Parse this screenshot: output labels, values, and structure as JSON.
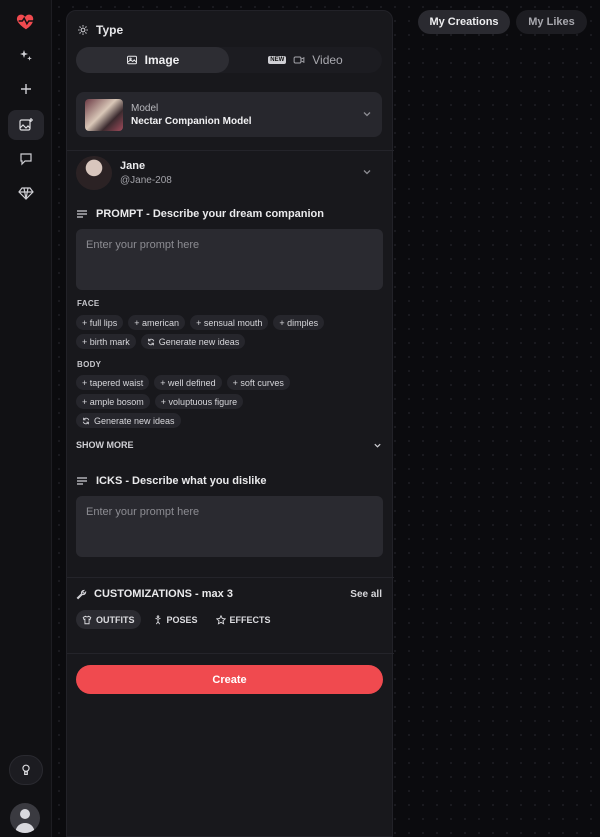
{
  "sidebar": {
    "items": [
      {
        "icon": "heart-pulse-logo-icon"
      },
      {
        "icon": "sparkles-icon"
      },
      {
        "icon": "plus-icon"
      },
      {
        "icon": "image-generate-icon",
        "active": true
      },
      {
        "icon": "chat-icon"
      },
      {
        "icon": "diamond-icon"
      }
    ],
    "bottom": {
      "hint_icon": "lightbulb-icon",
      "user_icon": "user-avatar-icon"
    }
  },
  "top_tabs": {
    "creations": "My Creations",
    "likes": "My Likes"
  },
  "type_section": {
    "title": "Type",
    "options": [
      "Image",
      "Video"
    ],
    "selected": "Image",
    "video_badge": "NEW"
  },
  "model": {
    "label": "Model",
    "name": "Nectar Companion Model"
  },
  "character": {
    "name": "Jane",
    "handle": "@Jane-208"
  },
  "prompt": {
    "title": "PROMPT - Describe your dream companion",
    "placeholder": "Enter your prompt here"
  },
  "face": {
    "label": "FACE",
    "chips": [
      "+ full lips",
      "+ american",
      "+ sensual mouth",
      "+ dimples",
      "+ birth mark"
    ],
    "generate": "Generate new ideas"
  },
  "body": {
    "label": "BODY",
    "chips": [
      "+ tapered waist",
      "+ well defined",
      "+ soft curves",
      "+ ample bosom",
      "+ voluptuous figure"
    ],
    "generate": "Generate new ideas"
  },
  "show_more": "SHOW MORE",
  "icks": {
    "title": "ICKS - Describe what you dislike",
    "placeholder": "Enter your prompt here"
  },
  "customizations": {
    "title": "CUSTOMIZATIONS - max 3",
    "see_all": "See all",
    "tabs": [
      "OUTFITS",
      "POSES",
      "EFFECTS"
    ],
    "selected": "OUTFITS"
  },
  "create_label": "Create",
  "colors": {
    "accent": "#f04a4f",
    "panel": "#18181c",
    "background": "#0b0b0e"
  }
}
